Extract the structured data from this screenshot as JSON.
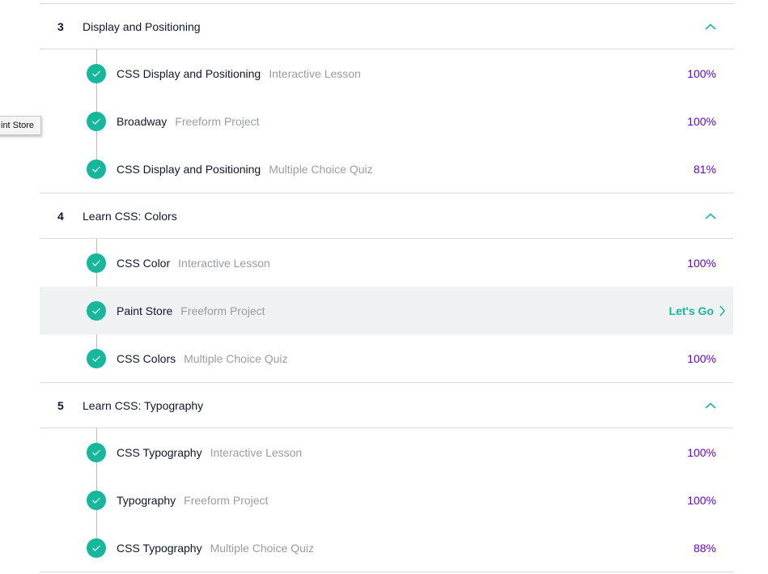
{
  "tooltip": {
    "text": "int Store"
  },
  "colors": {
    "accent": "#15b89a",
    "percent": "#6400e4",
    "text": "#10162f",
    "muted": "#9a9ca5",
    "active_row_bg": "#f0f1f3"
  },
  "sections": [
    {
      "number": "3",
      "title": "Display and Positioning",
      "icon": "chevron-up-icon",
      "items": [
        {
          "title": "CSS Display and Positioning",
          "type": "Interactive Lesson",
          "progress": "100%",
          "icon": "check-circle-icon"
        },
        {
          "title": "Broadway",
          "type": "Freeform Project",
          "progress": "100%",
          "icon": "check-circle-icon"
        },
        {
          "title": "CSS Display and Positioning",
          "type": "Multiple Choice Quiz",
          "progress": "81%",
          "icon": "check-circle-icon"
        }
      ]
    },
    {
      "number": "4",
      "title": "Learn CSS: Colors",
      "icon": "chevron-up-icon",
      "items": [
        {
          "title": "CSS Color",
          "type": "Interactive Lesson",
          "progress": "100%",
          "icon": "check-circle-icon"
        },
        {
          "title": "Paint Store",
          "type": "Freeform Project",
          "action": "Let's Go",
          "icon": "check-circle-icon"
        },
        {
          "title": "CSS Colors",
          "type": "Multiple Choice Quiz",
          "progress": "100%",
          "icon": "check-circle-icon"
        }
      ]
    },
    {
      "number": "5",
      "title": "Learn CSS: Typography",
      "icon": "chevron-up-icon",
      "items": [
        {
          "title": "CSS Typography",
          "type": "Interactive Lesson",
          "progress": "100%",
          "icon": "check-circle-icon"
        },
        {
          "title": "Typography",
          "type": "Freeform Project",
          "progress": "100%",
          "icon": "check-circle-icon"
        },
        {
          "title": "CSS Typography",
          "type": "Multiple Choice Quiz",
          "progress": "88%",
          "icon": "check-circle-icon"
        }
      ]
    }
  ]
}
